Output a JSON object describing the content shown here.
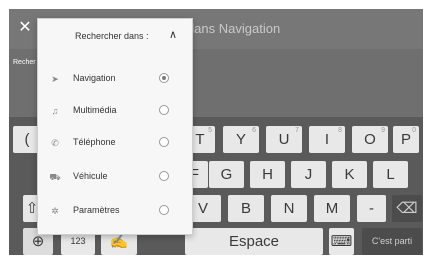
{
  "header": {
    "close_symbol": "✕",
    "title": "r dans Navigation"
  },
  "subbar": {
    "left_text": "Recher"
  },
  "dropdown": {
    "title": "Rechercher dans :",
    "caret_symbol": "∧",
    "items": [
      {
        "label": "Navigation",
        "icon": "navigation-arrow-icon",
        "icon_glyph": "➤",
        "selected": true
      },
      {
        "label": "Multimédia",
        "icon": "music-note-icon",
        "icon_glyph": "♫",
        "selected": false
      },
      {
        "label": "Téléphone",
        "icon": "phone-icon",
        "icon_glyph": "✆",
        "selected": false
      },
      {
        "label": "Véhicule",
        "icon": "vehicle-icon",
        "icon_glyph": "⛟",
        "selected": false
      },
      {
        "label": "Paramètres",
        "icon": "gear-icon",
        "icon_glyph": "✲",
        "selected": false
      }
    ]
  },
  "keyboard": {
    "row1": [
      {
        "label": "(",
        "num": ""
      },
      {
        "label": "T",
        "num": "5"
      },
      {
        "label": "Y",
        "num": "6"
      },
      {
        "label": "U",
        "num": "7"
      },
      {
        "label": "I",
        "num": "8"
      },
      {
        "label": "O",
        "num": "9"
      },
      {
        "label": "P",
        "num": "0"
      }
    ],
    "row2": [
      "F",
      "G",
      "H",
      "J",
      "K",
      "L"
    ],
    "row3": [
      "V",
      "B",
      "N",
      "M",
      "-"
    ],
    "row3_left_symbol": "⇧",
    "backspace_symbol": "⌫",
    "globe_symbol": "⊕",
    "numbers_label": "123",
    "handwriting_symbol": "✍",
    "space_label": "Espace",
    "hide_symbol": "⌨",
    "go_label": "C'est parti"
  }
}
